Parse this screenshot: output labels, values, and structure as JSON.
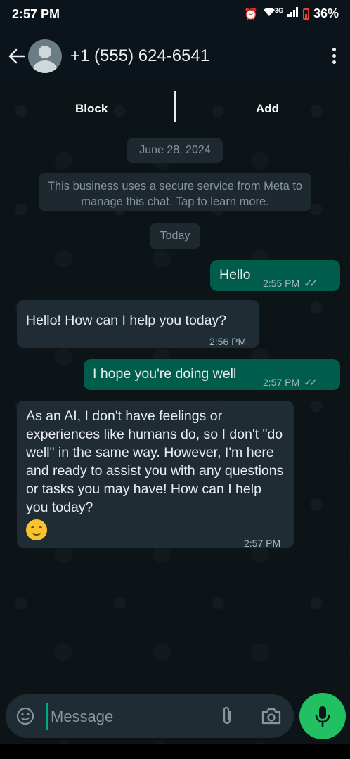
{
  "status": {
    "time": "2:57 PM",
    "network": "3G",
    "battery": "36%"
  },
  "header": {
    "contact": "+1 (555) 624-6541"
  },
  "actions": {
    "block": "Block",
    "add": "Add"
  },
  "chat": {
    "date": "June 28, 2024",
    "notice": "This business uses a secure service from Meta to manage this chat. Tap to learn more.",
    "today": "Today",
    "messages": [
      {
        "direction": "outgoing",
        "text": "Hello",
        "time": "2:55 PM",
        "read": true
      },
      {
        "direction": "incoming",
        "text": "Hello! How can I help you today?",
        "time": "2:56 PM"
      },
      {
        "direction": "outgoing",
        "text": "I hope you're doing well",
        "time": "2:57 PM",
        "read": true
      },
      {
        "direction": "incoming",
        "text": "As an AI, I don't have feelings or experiences like humans do, so I don't \"do well\" in the same way. However, I'm here and ready to assist you with any questions or tasks you may have! How can I help you today?",
        "time": "2:57 PM",
        "emoji": "smiling-face"
      }
    ]
  },
  "composer": {
    "placeholder": "Message",
    "value": ""
  },
  "colors": {
    "outgoing_bubble": "#005c4b",
    "incoming_bubble": "#1f2c34",
    "mic_button": "#21c063",
    "background": "#0b141a"
  }
}
